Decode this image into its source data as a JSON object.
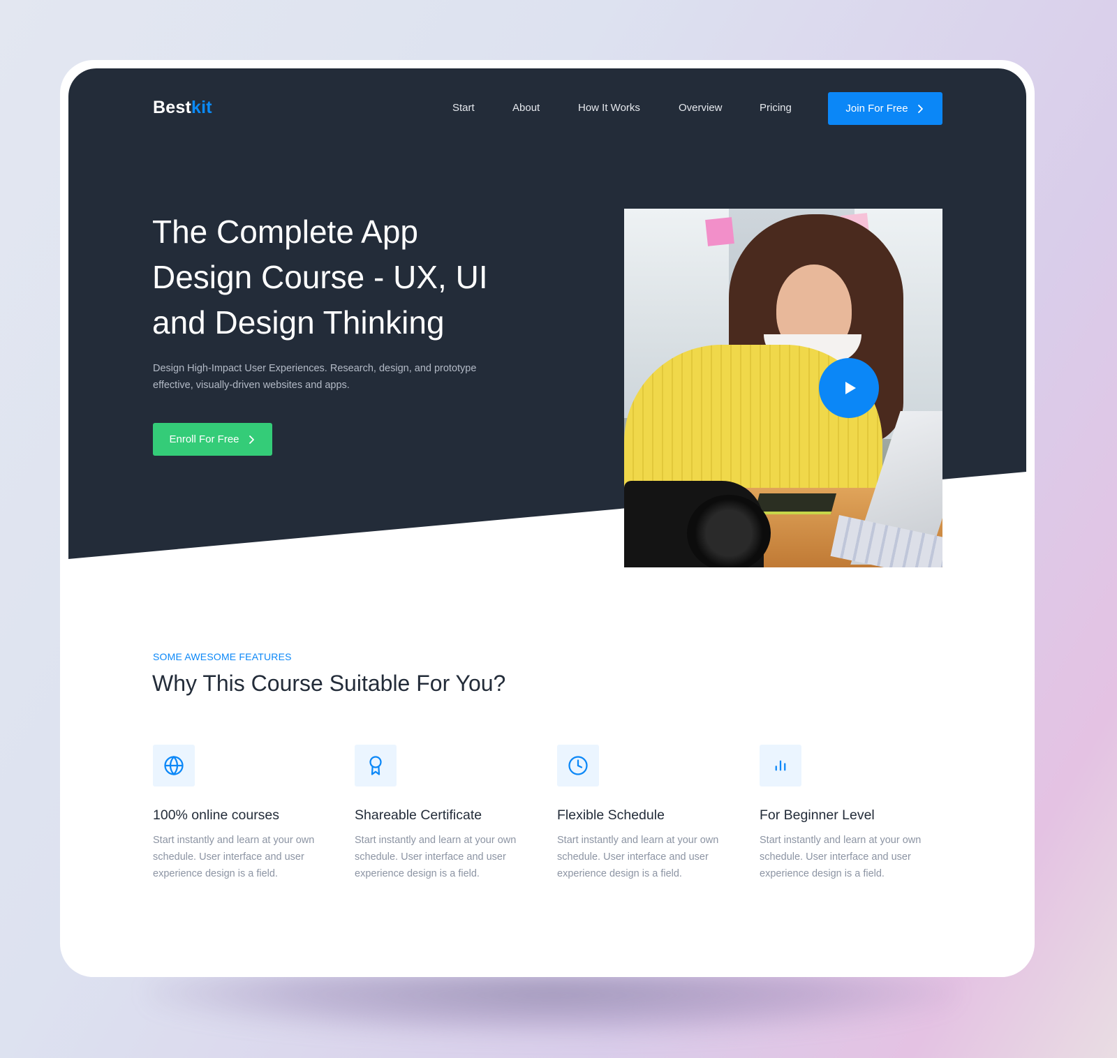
{
  "brand": {
    "name_primary": "Best",
    "name_accent": "kit",
    "primary_color": "#0b87f7",
    "dark_color": "#232c39",
    "success_color": "#34cc78"
  },
  "nav": {
    "links": [
      {
        "label": "Start"
      },
      {
        "label": "About"
      },
      {
        "label": "How It Works"
      },
      {
        "label": "Overview"
      },
      {
        "label": "Pricing"
      }
    ],
    "cta_label": "Join For Free",
    "cta_icon": "chevron-right-icon"
  },
  "hero": {
    "title_lines": [
      "The Complete App",
      "Design Course - UX, UI",
      "and Design Thinking"
    ],
    "subtitle": "Design High-Impact User Experiences. Research, design, and prototype effective, visually-driven websites and apps.",
    "cta_label": "Enroll For Free",
    "media": {
      "description": "Woman in yellow sweater drawing on a pen tablet beside a camera and laptop",
      "play_icon": "play-icon"
    }
  },
  "features": {
    "eyebrow": "SOME AWESOME FEATURES",
    "title": "Why This Course Suitable For You?",
    "items": [
      {
        "icon": "globe-icon",
        "title": "100% online courses",
        "description": "Start instantly and learn at your own schedule. User interface and user experience design is a field."
      },
      {
        "icon": "award-icon",
        "title": "Shareable Certificate",
        "description": "Start instantly and learn at your own schedule. User interface and user experience design is a field."
      },
      {
        "icon": "clock-icon",
        "title": "Flexible Schedule",
        "description": "Start instantly and learn at your own schedule. User interface and user experience design is a field."
      },
      {
        "icon": "bar-chart-icon",
        "title": "For Beginner Level",
        "description": "Start instantly and learn at your own schedule. User interface and user experience design is a field."
      }
    ]
  }
}
